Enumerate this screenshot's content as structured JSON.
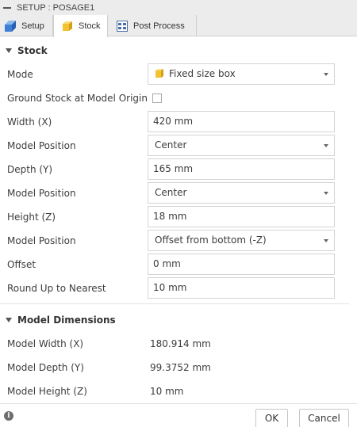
{
  "window": {
    "title": "SETUP : POSAGE1"
  },
  "tabs": [
    {
      "label": "Setup",
      "icon": "setup-icon"
    },
    {
      "label": "Stock",
      "icon": "stock-box-icon",
      "active": true
    },
    {
      "label": "Post Process",
      "icon": "post-process-icon"
    }
  ],
  "stock_section": {
    "title": "Stock",
    "mode": {
      "label": "Mode",
      "value": "Fixed size box",
      "icon": "stock-box-icon"
    },
    "ground_stock": {
      "label": "Ground Stock at Model Origin",
      "checked": false
    },
    "width": {
      "label": "Width (X)",
      "value": "420 mm"
    },
    "width_position": {
      "label": "Model Position",
      "value": "Center"
    },
    "depth": {
      "label": "Depth (Y)",
      "value": "165 mm"
    },
    "depth_position": {
      "label": "Model Position",
      "value": "Center"
    },
    "height": {
      "label": "Height (Z)",
      "value": "18 mm"
    },
    "height_position": {
      "label": "Model Position",
      "value": "Offset from bottom (-Z)"
    },
    "offset": {
      "label": "Offset",
      "value": "0 mm"
    },
    "round_up": {
      "label": "Round Up to Nearest",
      "value": "10 mm"
    }
  },
  "model_dimensions": {
    "title": "Model Dimensions",
    "width": {
      "label": "Model Width (X)",
      "value": "180.914 mm"
    },
    "depth": {
      "label": "Model Depth (Y)",
      "value": "99.3752 mm"
    },
    "height": {
      "label": "Model Height (Z)",
      "value": "10 mm"
    }
  },
  "footer": {
    "ok": "OK",
    "cancel": "Cancel",
    "info_icon": "info-icon"
  },
  "colors": {
    "stock_yellow": "#f2c230",
    "setup_blue": "#3d7ed6",
    "text": "#3c3c3c"
  }
}
